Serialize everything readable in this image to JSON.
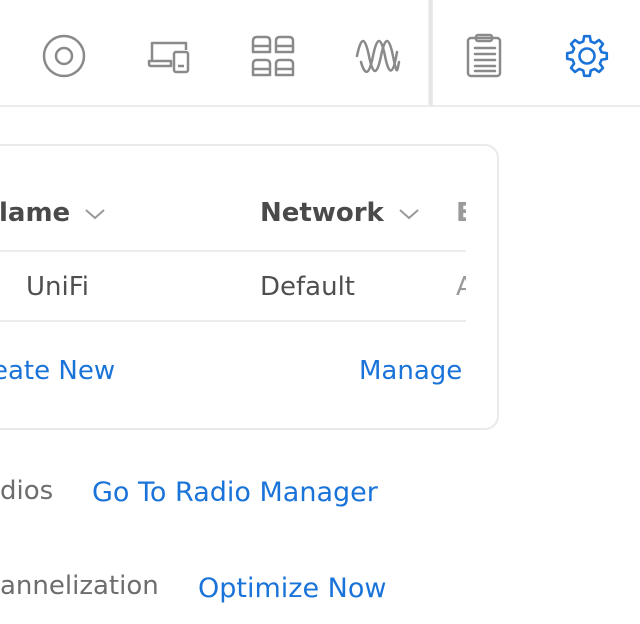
{
  "topbar": {
    "icons": [
      {
        "name": "radio-disc-icon"
      },
      {
        "name": "devices-icon"
      },
      {
        "name": "clients-grid-icon"
      },
      {
        "name": "wifi-waveform-icon"
      },
      {
        "name": "logs-clipboard-icon"
      },
      {
        "name": "settings-gear-icon"
      }
    ],
    "active_icon": "settings-gear-icon",
    "accent_color": "#1a73d9",
    "icon_color": "#8a8a8a"
  },
  "wifi_table": {
    "columns": [
      {
        "label": "lame"
      },
      {
        "label": "Network"
      },
      {
        "label": "E"
      }
    ],
    "rows": [
      {
        "name": "UniFi",
        "network": "Default",
        "extra": "A"
      }
    ],
    "actions": {
      "create_new": "eate New",
      "manage": "Manage"
    }
  },
  "settings_rows": [
    {
      "label": "dios",
      "action": "Go To Radio Manager"
    },
    {
      "label": "annelization",
      "action": "Optimize Now"
    }
  ]
}
